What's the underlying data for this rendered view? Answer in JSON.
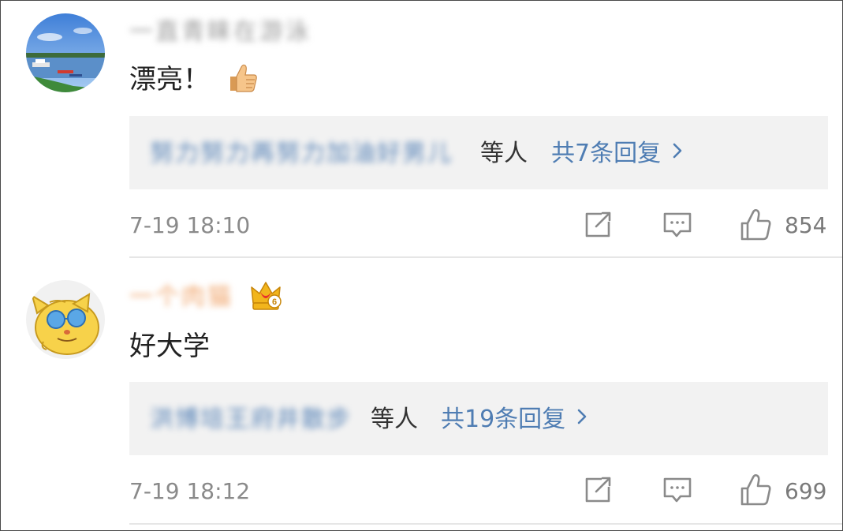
{
  "comments": [
    {
      "username": "一直青睐在游泳",
      "text": "漂亮！",
      "reply_users": "努力努力再努力加油好男儿",
      "reply_suffix": "等人",
      "reply_count": "共7条回复",
      "time": "7-19 18:10",
      "likes": "854",
      "avatar_icon": "lake-landscape-avatar",
      "emoji": "thumbs-up-emoji"
    },
    {
      "username": "一个肉猫",
      "text": "好大学",
      "reply_users": "洪博培王府井散步",
      "reply_suffix": "等人",
      "reply_count": "共19条回复",
      "time": "7-19 18:12",
      "likes": "699",
      "avatar_icon": "cartoon-cat-with-sunglasses-avatar",
      "badge_icon": "vip-crown-badge-level-6",
      "badge_level": "6"
    }
  ],
  "icons": {
    "repost": "repost-icon",
    "reply": "comment-icon",
    "like": "thumbs-up-icon",
    "chevron": "chevron-right-icon"
  },
  "colors": {
    "link": "#4f7db3",
    "reply_box_bg": "#f2f2f2",
    "meta_text": "#8a8a8a"
  }
}
